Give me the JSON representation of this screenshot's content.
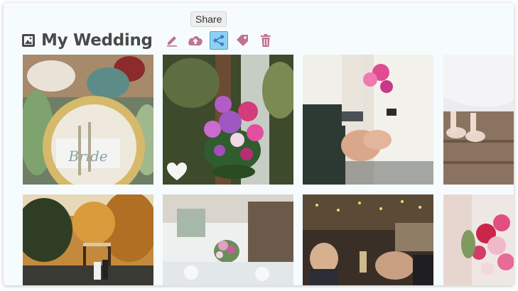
{
  "album": {
    "title": "My Wedding",
    "icon": "album-image-icon"
  },
  "toolbar": {
    "tools": [
      {
        "name": "edit",
        "icon": "pencil-icon"
      },
      {
        "name": "upload",
        "icon": "cloud-upload-icon"
      },
      {
        "name": "share",
        "icon": "share-icon",
        "active": true
      },
      {
        "name": "tag",
        "icon": "tag-icon"
      },
      {
        "name": "delete",
        "icon": "trash-icon"
      }
    ],
    "tooltip": "Share"
  },
  "colors": {
    "accent": "#c0738c",
    "active_bg": "#8fd0f2",
    "title": "#4a4a4a"
  },
  "photos": [
    {
      "name": "photo-table-setting",
      "favorite": false
    },
    {
      "name": "photo-bouquet",
      "favorite": true
    },
    {
      "name": "photo-holding-hands",
      "favorite": false
    },
    {
      "name": "photo-bride-shoes",
      "favorite": false
    },
    {
      "name": "photo-outdoor-ceremony",
      "favorite": false
    },
    {
      "name": "photo-reception-table",
      "favorite": false
    },
    {
      "name": "photo-toast",
      "favorite": false
    },
    {
      "name": "photo-bouquet-closeup",
      "favorite": false
    }
  ],
  "table_card_text": "Bride"
}
